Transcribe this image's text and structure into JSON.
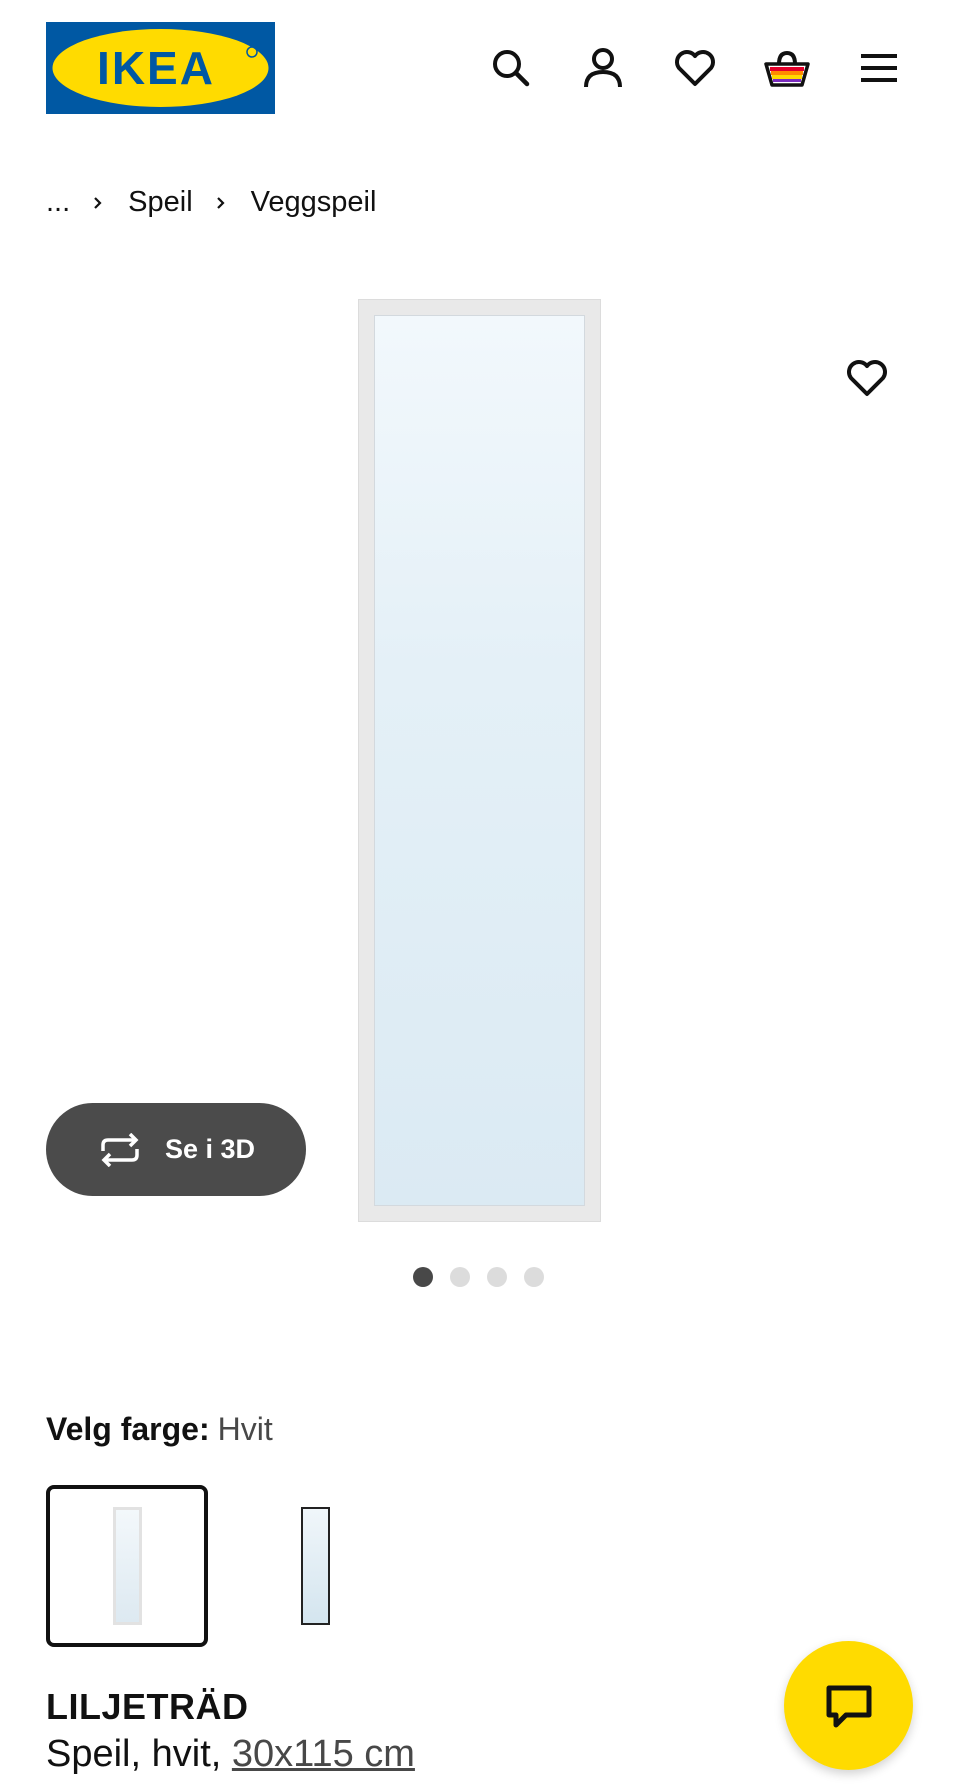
{
  "brand": {
    "logo_text": "IKEA",
    "colors": {
      "blue": "#0058a3",
      "yellow": "#ffdb00"
    }
  },
  "header": {
    "icons": [
      "search-icon",
      "account-icon",
      "heart-icon",
      "basket-icon",
      "menu-icon"
    ]
  },
  "breadcrumb": {
    "ellipsis": "...",
    "items": [
      "Speil",
      "Veggspeil"
    ]
  },
  "media": {
    "view_3d_label": "Se i 3D",
    "image_count": 4,
    "active_index": 1
  },
  "color_picker": {
    "label": "Velg farge:",
    "value": "Hvit",
    "options": [
      "hvit",
      "svart"
    ],
    "selected_index": 0
  },
  "product": {
    "name": "LILJETRÄD",
    "description_prefix": "Speil, hvit,",
    "size": "30x115 cm"
  }
}
